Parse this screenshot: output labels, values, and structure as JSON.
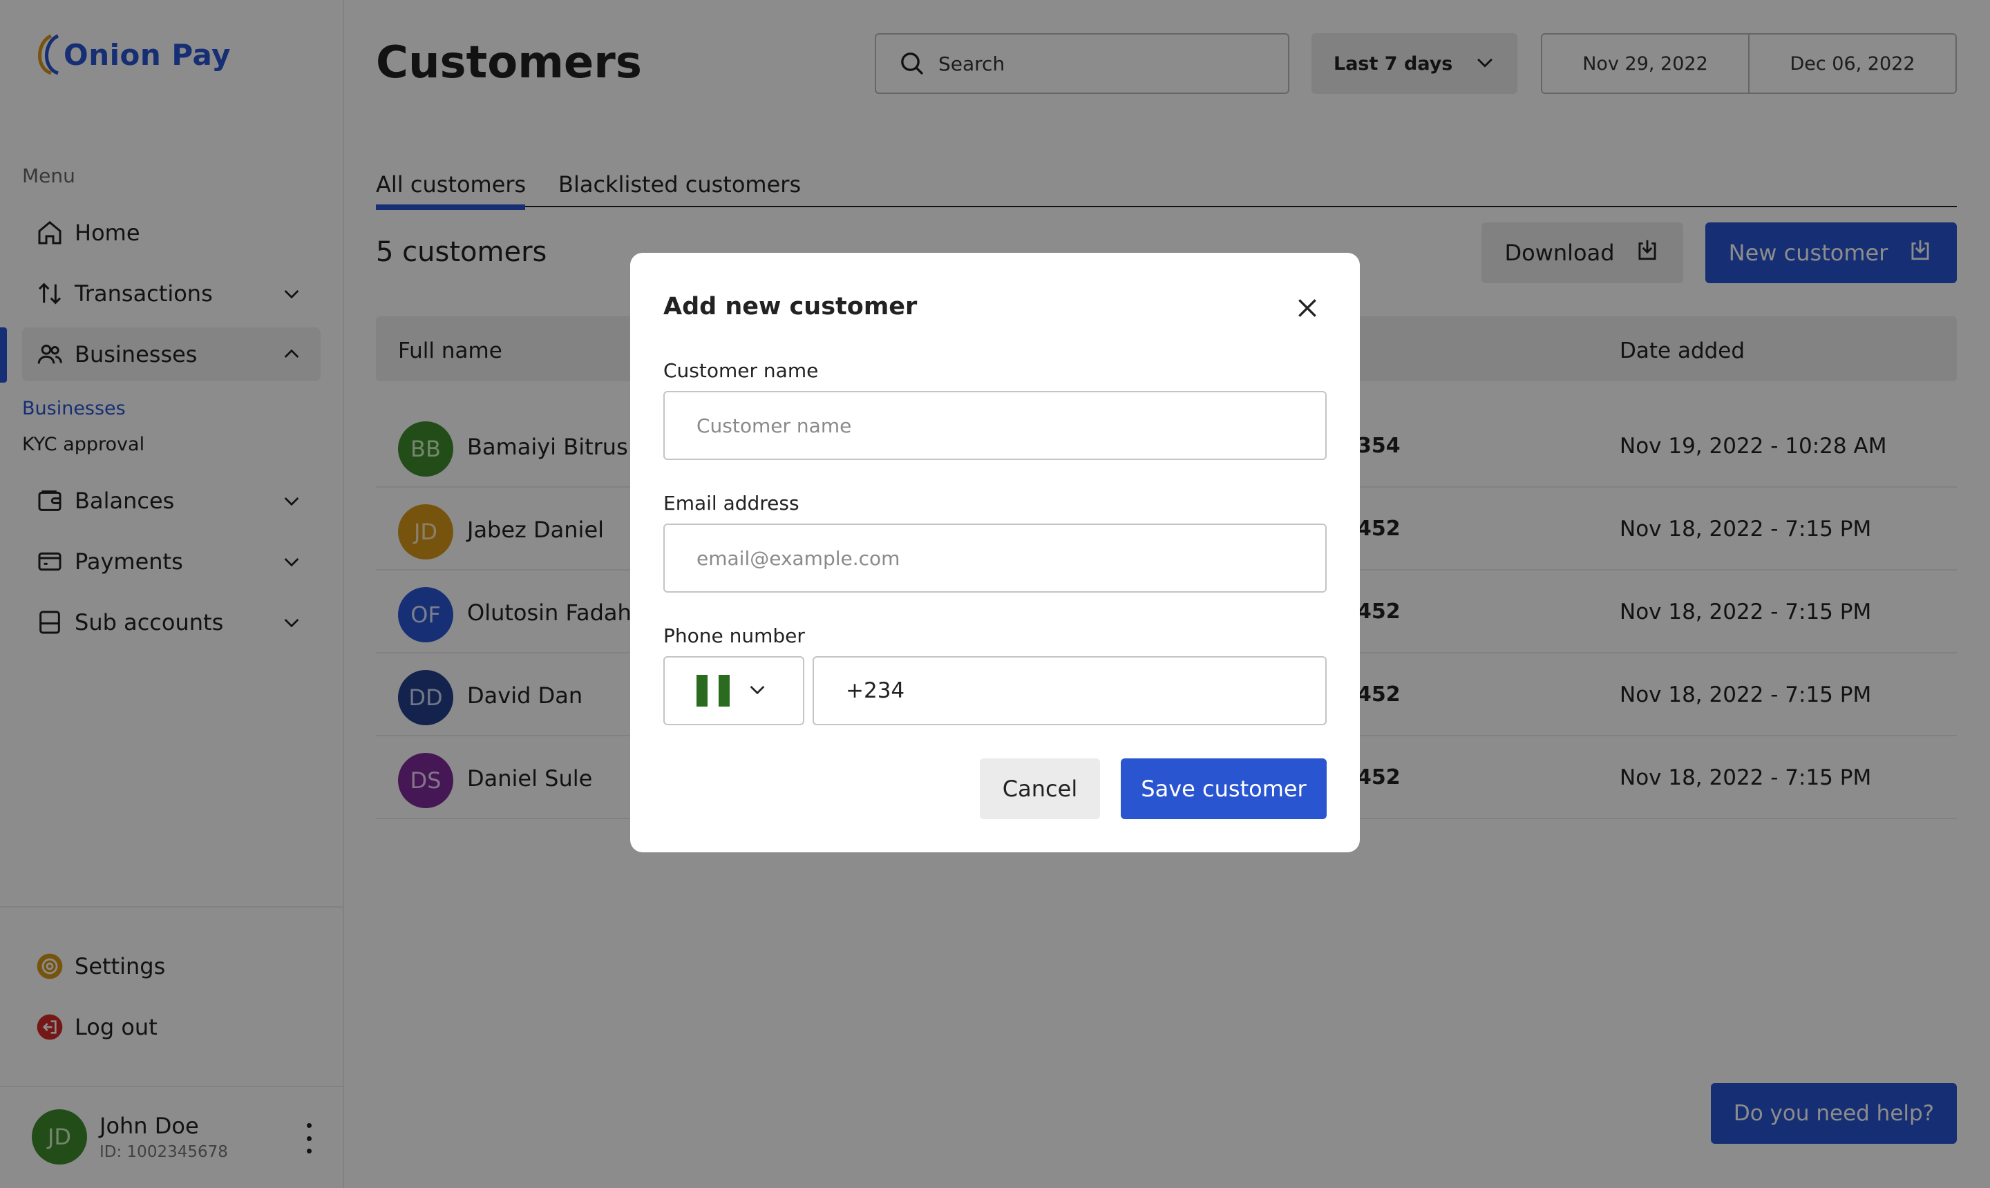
{
  "app": {
    "name": "Onion Pay",
    "brand_color": "#2955d1"
  },
  "sidebar": {
    "menu_label": "Menu",
    "items": [
      {
        "label": "Home",
        "icon": "home-icon"
      },
      {
        "label": "Transactions",
        "icon": "arrows-updown-icon"
      },
      {
        "label": "Businesses",
        "icon": "users-icon",
        "expanded": true
      },
      {
        "label": "Balances",
        "icon": "wallet-icon"
      },
      {
        "label": "Payments",
        "icon": "card-icon"
      },
      {
        "label": "Sub accounts",
        "icon": "folder-icon"
      }
    ],
    "sub_items": [
      {
        "label": "Businesses",
        "active": true
      },
      {
        "label": "KYC approval",
        "active": false
      }
    ],
    "bottom": [
      {
        "label": "Settings",
        "icon": "gear-icon"
      },
      {
        "label": "Log out",
        "icon": "logout-icon"
      }
    ],
    "user": {
      "initials": "JD",
      "name": "John Doe",
      "id": "ID: 1002345678"
    }
  },
  "header": {
    "title": "Customers",
    "search_placeholder": "Search",
    "range": "Last 7 days",
    "date_from": "Nov 29, 2022",
    "date_to": "Dec 06, 2022"
  },
  "tabs": [
    {
      "label": "All customers",
      "active": true
    },
    {
      "label": "Blacklisted customers",
      "active": false
    }
  ],
  "summary": {
    "count_text": "5 customers"
  },
  "actions": {
    "download": "Download",
    "new_customer": "New customer"
  },
  "table": {
    "headers": {
      "name": "Full name",
      "date": "Date added"
    },
    "rows": [
      {
        "initials": "BB",
        "name": "Bamaiyi Bitrus",
        "phone_tail": "354",
        "date": "Nov 19, 2022 - 10:28 AM",
        "color": "#3f8a2c",
        "text_color": "#d6f2c9"
      },
      {
        "initials": "JD",
        "name": "Jabez Daniel",
        "phone_tail": "452",
        "date": "Nov 18, 2022 - 7:15 PM",
        "color": "#d99a1a",
        "text_color": "#fbe9c4"
      },
      {
        "initials": "OF",
        "name": "Olutosin Fadah",
        "phone_tail": "452",
        "date": "Nov 18, 2022 - 7:15 PM",
        "color": "#2a57d4",
        "text_color": "#dfe7ff"
      },
      {
        "initials": "DD",
        "name": "David Dan",
        "phone_tail": "452",
        "date": "Nov 18, 2022 - 7:15 PM",
        "color": "#24408f",
        "text_color": "#cfd9f5"
      },
      {
        "initials": "DS",
        "name": "Daniel Sule",
        "phone_tail": "452",
        "date": "Nov 18, 2022 - 7:15 PM",
        "color": "#7e2a9c",
        "text_color": "#eed5f7"
      }
    ]
  },
  "help": {
    "label": "Do you need help?"
  },
  "modal": {
    "title": "Add new customer",
    "name_label": "Customer name",
    "name_placeholder": "Customer name",
    "email_label": "Email address",
    "email_placeholder": "email@example.com",
    "phone_label": "Phone number",
    "country_flag": "nigeria-flag-icon",
    "phone_value": "+234",
    "cancel": "Cancel",
    "save": "Save customer"
  }
}
